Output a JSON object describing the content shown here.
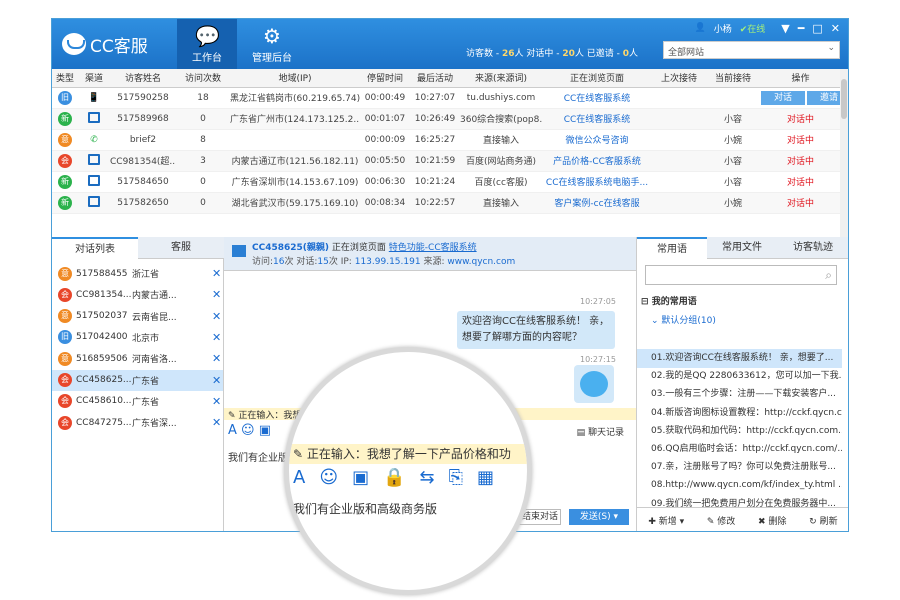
{
  "app": {
    "name": "CC客服"
  },
  "tabs": [
    {
      "label": "工作台"
    },
    {
      "label": "管理后台"
    }
  ],
  "user": {
    "name": "小杨",
    "status": "在线"
  },
  "stats": {
    "p1": "访客数 -",
    "visitors": "26",
    "p2": "人 对话中 -",
    "talking": "20",
    "p3": "人 已邀请 -",
    "invited": "0",
    "p4": "人"
  },
  "site": {
    "value": "全部网站"
  },
  "table": {
    "headers": [
      "类型",
      "渠道",
      "访客姓名",
      "访问次数",
      "地域(IP)",
      "停留时间",
      "最后活动",
      "来源(来源词)",
      "正在浏览页面",
      "上次接待",
      "当前接待",
      "操作"
    ],
    "rows": [
      {
        "type": "旧",
        "type_color": "#3a8fe0",
        "channel": "mobile",
        "name": "517590258",
        "visits": "18",
        "region": "黑龙江省鹤岗市(60.219.65.74)",
        "stay": "00:00:49",
        "last": "10:27:07",
        "source": "tu.dushiys.com",
        "page": "CC在线客服系统",
        "prev": "",
        "curr": "",
        "op1": "对话",
        "op2": "邀请"
      },
      {
        "type": "新",
        "type_color": "#2bb24c",
        "channel": "pc",
        "name": "517589968",
        "visits": "0",
        "region": "广东省广州市(124.173.125.2...",
        "stay": "00:01:07",
        "last": "10:26:49",
        "source": "360综合搜索(pop8...",
        "page": "CC在线客服系统",
        "prev": "",
        "curr": "小容",
        "op1": "对话中"
      },
      {
        "type": "意",
        "type_color": "#f08a24",
        "channel": "wechat",
        "name": "brief2",
        "visits": "8",
        "region": "",
        "stay": "00:00:09",
        "last": "16:25:27",
        "source": "直接输入",
        "page": "微信公众号咨询",
        "prev": "",
        "curr": "小婉",
        "op1": "对话中"
      },
      {
        "type": "会",
        "type_color": "#e8462a",
        "channel": "pc",
        "name": "CC981354(超...",
        "visits": "3",
        "region": "内蒙古通辽市(121.56.182.11)",
        "stay": "00:05:50",
        "last": "10:21:59",
        "source": "百度(网站商务通)",
        "page": "产品价格-CC客服系统",
        "prev": "",
        "curr": "小容",
        "op1": "对话中"
      },
      {
        "type": "新",
        "type_color": "#2bb24c",
        "channel": "pc",
        "name": "517584650",
        "visits": "0",
        "region": "广东省深圳市(14.153.67.109)",
        "stay": "00:06:30",
        "last": "10:21:24",
        "source": "百度(cc客服)",
        "page": "CC在线客服系统电脑手...",
        "prev": "",
        "curr": "小容",
        "op1": "对话中"
      },
      {
        "type": "新",
        "type_color": "#2bb24c",
        "channel": "pc",
        "name": "517582650",
        "visits": "0",
        "region": "湖北省武汉市(59.175.169.10)",
        "stay": "00:08:34",
        "last": "10:22:57",
        "source": "直接输入",
        "page": "客户案例-cc在线客服",
        "prev": "",
        "curr": "小婉",
        "op1": "对话中"
      }
    ]
  },
  "left": {
    "tabs": [
      "对话列表",
      "客服"
    ],
    "items": [
      {
        "b": "意",
        "c": "#f08a24",
        "name": "517588455",
        "region": "浙江省"
      },
      {
        "b": "会",
        "c": "#e8462a",
        "name": "CC981354...",
        "region": "内蒙古通..."
      },
      {
        "b": "意",
        "c": "#f08a24",
        "name": "517502037",
        "region": "云南省昆..."
      },
      {
        "b": "旧",
        "c": "#3a8fe0",
        "name": "517042400",
        "region": "北京市"
      },
      {
        "b": "意",
        "c": "#f08a24",
        "name": "516859506",
        "region": "河南省洛..."
      },
      {
        "b": "会",
        "c": "#e8462a",
        "name": "CC458625...",
        "region": "广东省",
        "sel": true
      },
      {
        "b": "会",
        "c": "#e8462a",
        "name": "CC458610...",
        "region": "广东省"
      },
      {
        "b": "会",
        "c": "#e8462a",
        "name": "CC847275...",
        "region": "广东省深..."
      }
    ]
  },
  "chat": {
    "visitor": "CC458625(親親)",
    "browsing": "正在浏览页面",
    "page_link": "特色功能-CC客服系统",
    "line2_prefix": "访问:",
    "visits": "16",
    "line2_mid1": "次 对话:",
    "talks": "15",
    "line2_mid2": "次 IP:",
    "ip": "113.99.15.191",
    "line2_mid3": "来源:",
    "src": "www.qycn.com",
    "t1": "10:27:05",
    "msg": "欢迎咨询CC在线客服系统！ 亲，想要了解哪方面的内容呢？",
    "t2": "10:27:15",
    "typing": "正在输入：我想了解一下产品价格和功",
    "history": "聊天记录",
    "input": "我们有企业版和高级商务版",
    "end": "结束对话",
    "send": "发送(S)"
  },
  "right": {
    "tabs": [
      "常用语",
      "常用文件",
      "访客轨迹"
    ],
    "group_title": "我的常用语",
    "group": "默认分组(10)",
    "items": [
      "01.欢迎咨询CC在线客服系统！ 亲，想要了...",
      "02.我的是QQ 2280633612，您可以加一下我...",
      "03.一般有三个步骤：注册——下载安装客户...",
      "04.新版咨询图标设置教程：http://cckf.qycn.com...",
      "05.获取代码和加代码：http://cckf.qycn.com...",
      "06.QQ启用临时会话：http://cckf.qycn.com/...",
      "07.亲，注册账号了吗？你可以免费注册账号...",
      "08.http://www.qycn.com/kf/index_ty.html ...",
      "09.我们统一把免费用户划分在免费服务器中..."
    ],
    "actions": [
      "新增",
      "修改",
      "删除",
      "刷新"
    ]
  },
  "lens": {
    "typing": "正在输入：我想了解一下产品价格和功",
    "input": "我们有企业版和高级商务版"
  }
}
